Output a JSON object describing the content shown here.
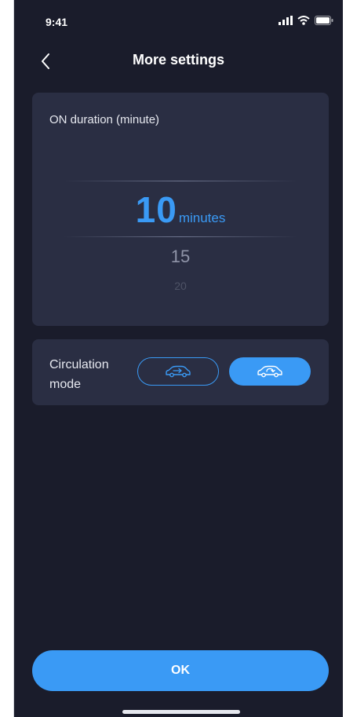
{
  "status_bar": {
    "time": "9:41",
    "icons": [
      "signal-icon",
      "wifi-icon",
      "battery-icon"
    ]
  },
  "header": {
    "back_icon": "chevron-left-icon",
    "title": "More settings"
  },
  "duration_card": {
    "label": "ON duration (minute)",
    "selected_value": "10",
    "selected_unit": "minutes",
    "next_options": [
      "15",
      "20"
    ]
  },
  "circulation_card": {
    "label": "Circulation mode",
    "modes": [
      {
        "icon": "car-outer-circulation-icon",
        "selected": false
      },
      {
        "icon": "car-inner-circulation-icon",
        "selected": true
      }
    ]
  },
  "ok_button": {
    "label": "OK"
  },
  "colors": {
    "background": "#1a1c2b",
    "card": "#2a2e43",
    "accent": "#3a9af5",
    "text": "#ffffff"
  }
}
